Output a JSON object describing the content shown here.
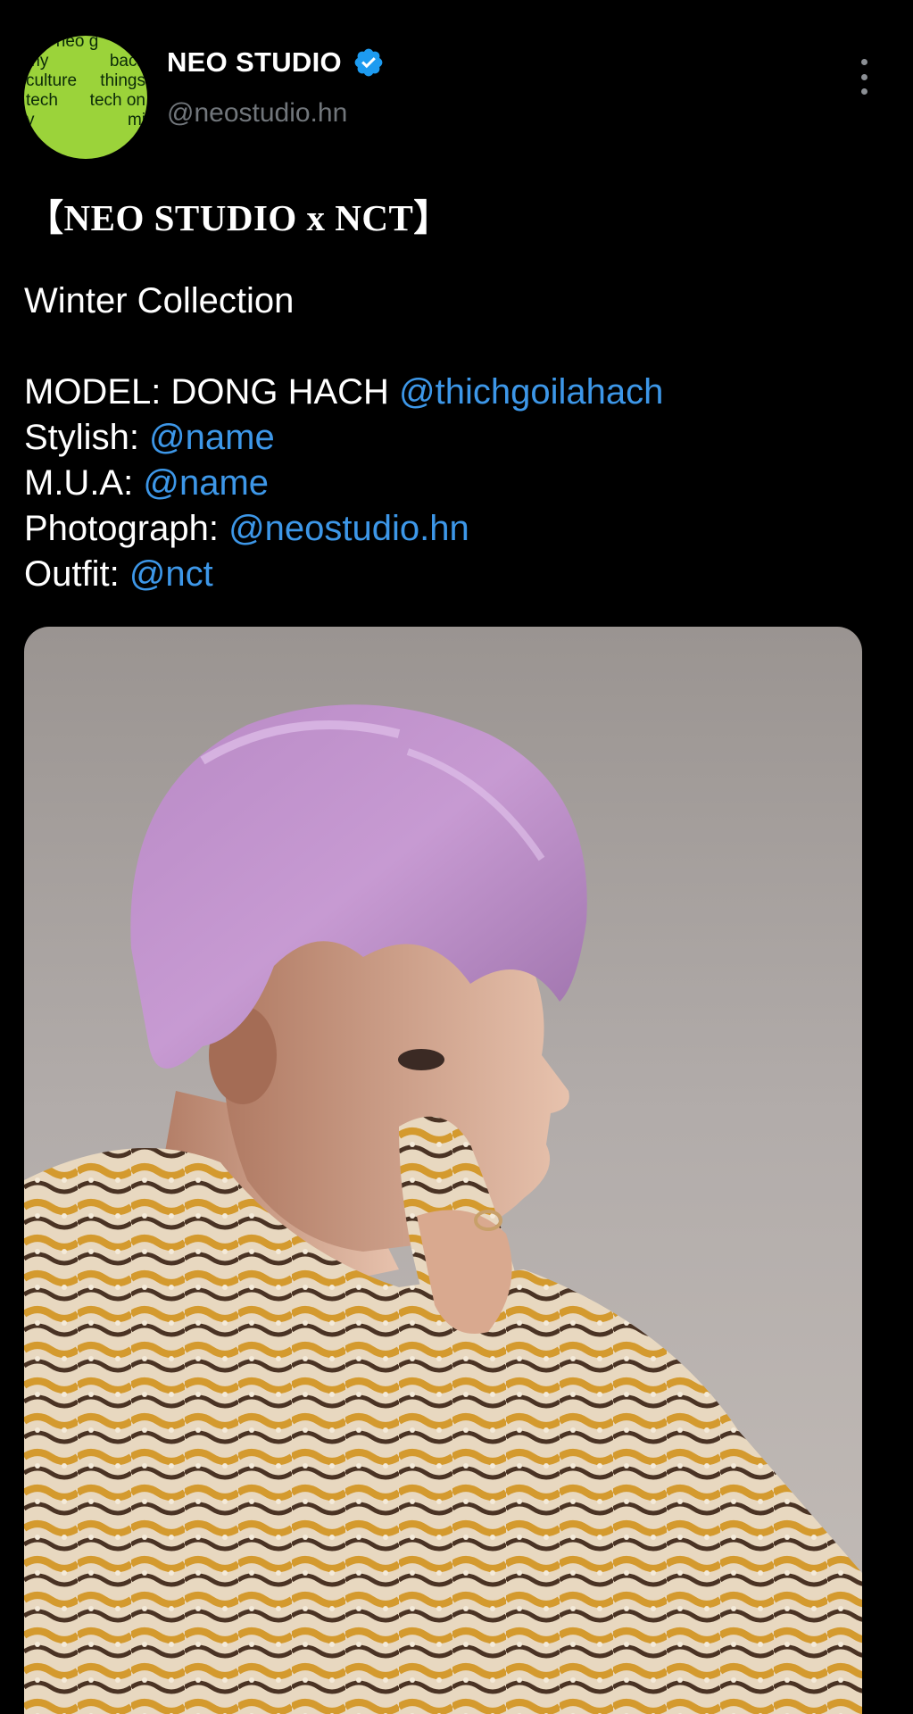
{
  "author": {
    "display_name": "NEO STUDIO",
    "handle": "@neostudio.hn",
    "avatar_lines": [
      [
        "n-n-neo g",
        ""
      ],
      [
        "my",
        "back"
      ],
      [
        "culture",
        "things"
      ],
      [
        "tech",
        "tech on"
      ],
      [
        "y",
        "mi"
      ]
    ]
  },
  "tweet": {
    "title": "【NEO STUDIO x NCT】",
    "subtitle": "Winter Collection",
    "credits": [
      {
        "label": "MODEL: DONG HACH ",
        "mention": "@thichgoilahach"
      },
      {
        "label": "Stylish: ",
        "mention": "@name"
      },
      {
        "label": "M.U.A: ",
        "mention": "@name"
      },
      {
        "label": "Photograph: ",
        "mention": "@neostudio.hn"
      },
      {
        "label": "Outfit: ",
        "mention": "@nct"
      }
    ]
  },
  "colors": {
    "background": "#000000",
    "mention": "#3d97e8",
    "handle": "#71767b",
    "verified": "#1d9bf0",
    "avatar_bg": "#9bd33a"
  },
  "icons": {
    "verified": "verified-badge-icon",
    "more": "more-vertical-icon"
  }
}
